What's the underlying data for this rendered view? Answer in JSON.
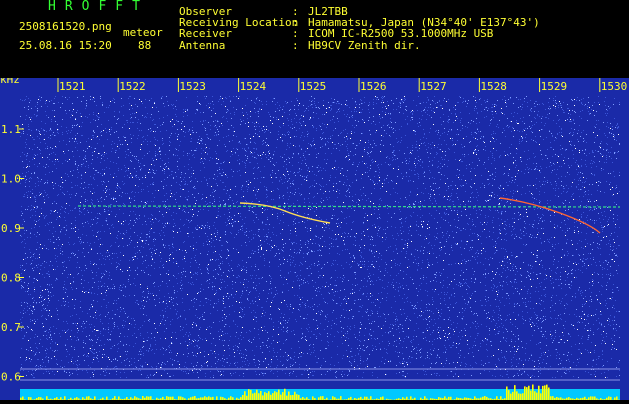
{
  "header": {
    "app_title": "HROFFT",
    "filename": "2508161520.png",
    "timestamp": "25.08.16 15:20",
    "meteor_label": "meteor",
    "meteor_count": "88",
    "fields": [
      {
        "label": "Observer",
        "sep": ":",
        "value": "JL2TBB"
      },
      {
        "label": "Receiving Location",
        "sep": ":",
        "value": "Hamamatsu, Japan (N34°40' E137°43')"
      },
      {
        "label": "Receiver",
        "sep": ":",
        "value": "ICOM IC-R2500 53.1000MHz USB"
      },
      {
        "label": "Antenna",
        "sep": ":",
        "value": "HB9CV Zenith dir."
      }
    ]
  },
  "spectrogram": {
    "y_unit": "kHz",
    "y_ticks": [
      "1.1",
      "1.0",
      "0.9",
      "0.8",
      "0.7",
      "0.6"
    ],
    "x_ticks": [
      "1521",
      "1522",
      "1523",
      "1524",
      "1525",
      "1526",
      "1527",
      "1528",
      "1529",
      "1530"
    ],
    "colors": {
      "background": "#1a2aa8",
      "noise_low": "#3a55d8",
      "noise_high": "#ffffff",
      "axis_text": "#ffff33",
      "carrier": "#33dd88",
      "level_bar": "#00c8ff",
      "level_peak": "#ffff00"
    }
  }
}
